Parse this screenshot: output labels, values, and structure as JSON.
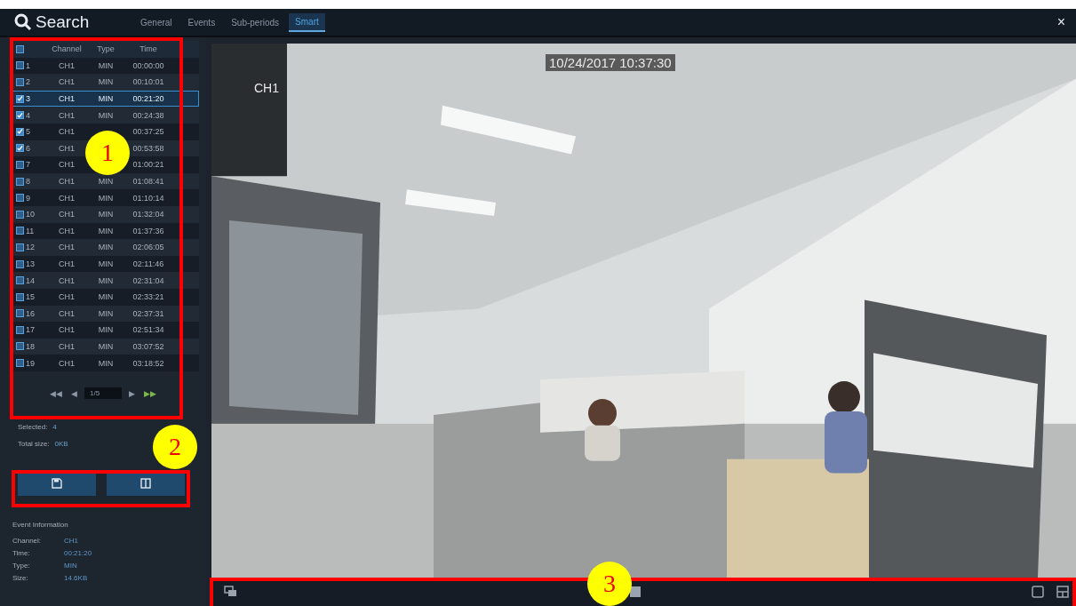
{
  "window": {
    "title": "Search",
    "close": "×"
  },
  "tabs": [
    {
      "label": "General",
      "selected": false
    },
    {
      "label": "Events",
      "selected": false
    },
    {
      "label": "Sub-periods",
      "selected": false
    },
    {
      "label": "Smart",
      "selected": true
    }
  ],
  "table": {
    "select_all": {
      "checked": false
    },
    "columns": [
      "Channel",
      "Type",
      "Time"
    ],
    "rows": [
      {
        "index": "1",
        "channel": "CH1",
        "type": "MIN",
        "time": "00:00:00",
        "checked": false,
        "selected": false
      },
      {
        "index": "2",
        "channel": "CH1",
        "type": "MIN",
        "time": "00:10:01",
        "checked": false,
        "selected": false
      },
      {
        "index": "3",
        "channel": "CH1",
        "type": "MIN",
        "time": "00:21:20",
        "checked": true,
        "selected": true
      },
      {
        "index": "4",
        "channel": "CH1",
        "type": "MIN",
        "time": "00:24:38",
        "checked": true,
        "selected": false
      },
      {
        "index": "5",
        "channel": "CH1",
        "time": "00:37:25",
        "checked": true,
        "selected": false
      },
      {
        "index": "6",
        "channel": "CH1",
        "time": "00:53:58",
        "checked": true,
        "selected": false
      },
      {
        "index": "7",
        "channel": "CH1",
        "time": "01:00:21",
        "checked": false,
        "selected": false
      },
      {
        "index": "8",
        "channel": "CH1",
        "type": "MIN",
        "time": "01:08:41",
        "checked": false,
        "selected": false
      },
      {
        "index": "9",
        "channel": "CH1",
        "type": "MIN",
        "time": "01:10:14",
        "checked": false,
        "selected": false
      },
      {
        "index": "10",
        "channel": "CH1",
        "type": "MIN",
        "time": "01:32:04",
        "checked": false,
        "selected": false
      },
      {
        "index": "11",
        "channel": "CH1",
        "type": "MIN",
        "time": "01:37:36",
        "checked": false,
        "selected": false
      },
      {
        "index": "12",
        "channel": "CH1",
        "type": "MIN",
        "time": "02:06:05",
        "checked": false,
        "selected": false
      },
      {
        "index": "13",
        "channel": "CH1",
        "type": "MIN",
        "time": "02:11:46",
        "checked": false,
        "selected": false
      },
      {
        "index": "14",
        "channel": "CH1",
        "type": "MIN",
        "time": "02:31:04",
        "checked": false,
        "selected": false
      },
      {
        "index": "15",
        "channel": "CH1",
        "type": "MIN",
        "time": "02:33:21",
        "checked": false,
        "selected": false
      },
      {
        "index": "16",
        "channel": "CH1",
        "type": "MIN",
        "time": "02:37:31",
        "checked": false,
        "selected": false
      },
      {
        "index": "17",
        "channel": "CH1",
        "type": "MIN",
        "time": "02:51:34",
        "checked": false,
        "selected": false
      },
      {
        "index": "18",
        "channel": "CH1",
        "type": "MIN",
        "time": "03:07:52",
        "checked": false,
        "selected": false
      },
      {
        "index": "19",
        "channel": "CH1",
        "type": "MIN",
        "time": "03:18:52",
        "checked": false,
        "selected": false
      }
    ]
  },
  "pagination": {
    "first": "◀◀",
    "prev": "◀",
    "page": "1/5",
    "next": "▶",
    "last": "▶▶"
  },
  "summary": [
    {
      "label": "Selected:",
      "value": "4"
    },
    {
      "label": "Total size:",
      "value": "0KB"
    }
  ],
  "event_information": {
    "title": "Event Information",
    "fields": [
      {
        "label": "Channel:",
        "value": "CH1"
      },
      {
        "label": "Time:",
        "value": "00:21:20"
      },
      {
        "label": "Type:",
        "value": "MIN"
      },
      {
        "label": "Size:",
        "value": "14.6KB"
      }
    ]
  },
  "video": {
    "kind": "picture",
    "timestamp": "10/24/2017 10:37:30",
    "channel": "CH1"
  },
  "callouts": [
    {
      "label": "1"
    },
    {
      "label": "2"
    },
    {
      "label": "3"
    }
  ]
}
